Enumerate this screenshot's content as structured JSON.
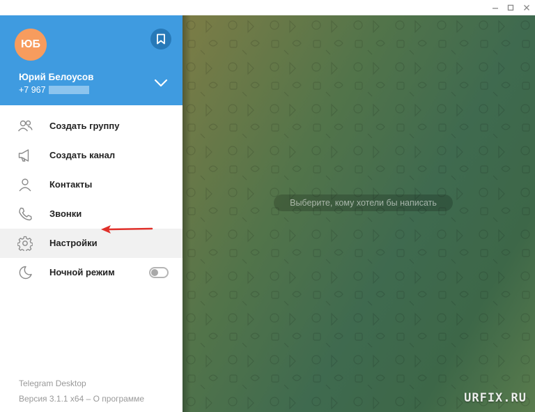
{
  "window": {
    "controls": [
      "minimize-icon",
      "maximize-icon",
      "close-icon"
    ]
  },
  "sidebar": {
    "avatar_initials": "ЮБ",
    "user_name": "Юрий Белоусов",
    "user_phone": "+7 967",
    "menu": [
      {
        "label": "Создать группу",
        "icon": "group-icon"
      },
      {
        "label": "Создать канал",
        "icon": "megaphone-icon"
      },
      {
        "label": "Контакты",
        "icon": "contact-icon"
      },
      {
        "label": "Звонки",
        "icon": "phone-icon"
      },
      {
        "label": "Настройки",
        "icon": "settings-gear-icon"
      },
      {
        "label": "Ночной режим",
        "icon": "moon-icon"
      }
    ],
    "night_mode_enabled": false,
    "footer_app": "Telegram Desktop",
    "footer_version": "Версия 3.1.1 x64 – О программе"
  },
  "chat": {
    "placeholder": "Выберите, кому хотели бы написать"
  },
  "watermark": "URFIX.RU",
  "colors": {
    "header": "#3f9be0",
    "avatar": "#f79c5e",
    "saved_button": "#2779b8",
    "arrow": "#e0302a",
    "active_item_bg": "#f1f1f1"
  }
}
